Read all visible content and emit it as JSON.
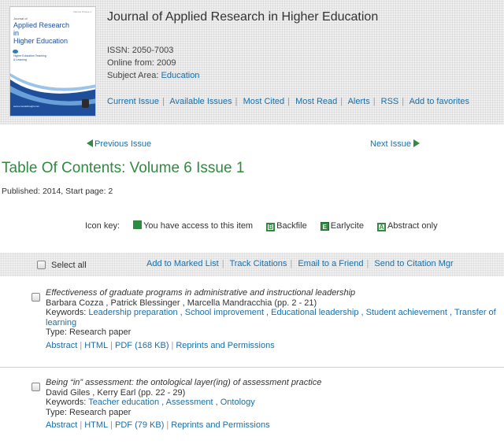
{
  "journal": {
    "title": "Journal of Applied Research in Higher Education",
    "issn": "ISSN: 2050-7003",
    "online_from": "Online from: 2009",
    "subject_label": "Subject Area: ",
    "subject_value": "Education",
    "cover": {
      "small_text": "Journal of",
      "title_line1": "Applied Research in",
      "title_line2": "Higher Education",
      "corner_text": "Volume 6 Issue 1",
      "logo_text": "Higher Education Teaching & Learning",
      "url_text": "www.emeraldinsight.com"
    }
  },
  "nav_links": [
    "Current Issue",
    "Available Issues",
    "Most Cited",
    "Most Read",
    "Alerts",
    "RSS",
    "Add to favorites"
  ],
  "pager": {
    "prev": "Previous Issue",
    "next": "Next Issue"
  },
  "toc": {
    "title": "Table Of Contents: Volume 6 Issue 1",
    "published": "Published: 2014, Start page: 2"
  },
  "icon_key": {
    "label": "Icon key:",
    "items": [
      {
        "letter": "",
        "text": "You have access to this item"
      },
      {
        "letter": "B",
        "text": "Backfile"
      },
      {
        "letter": "E",
        "text": "Earlycite"
      },
      {
        "letter": "A",
        "text": "Abstract only"
      }
    ]
  },
  "action_bar": {
    "select_all": "Select all",
    "links": [
      "Add to Marked List",
      "Track Citations",
      "Email to a Friend",
      "Send to Citation Mgr"
    ]
  },
  "articles": [
    {
      "title": "Effectiveness of graduate programs in administrative and instructional leadership",
      "authors": "Barbara Cozza , Patrick Blessinger , Marcella Mandracchia (pp. 2 - 21)",
      "keywords_label": "Keywords: ",
      "keywords": "Leadership preparation , School improvement , Educational leadership , Student achievement , Transfer of learning",
      "type": "Type: Research paper",
      "links": [
        "Abstract",
        "HTML",
        "PDF (168 KB)",
        "Reprints and Permissions"
      ]
    },
    {
      "title": "Being “in” assessment: the ontological layer(ing) of assessment practice",
      "authors": "David Giles , Kerry Earl (pp. 22 - 29)",
      "keywords_label": "Keywords: ",
      "keywords": "Teacher education , Assessment , Ontology",
      "type": "Type: Research paper",
      "links": [
        "Abstract",
        "HTML",
        "PDF (79 KB)",
        "Reprints and Permissions"
      ]
    }
  ],
  "colors": {
    "accent_green": "#2e8b3f",
    "link_blue": "#1a6fa8",
    "cover_blue": "#1f4e9a"
  }
}
